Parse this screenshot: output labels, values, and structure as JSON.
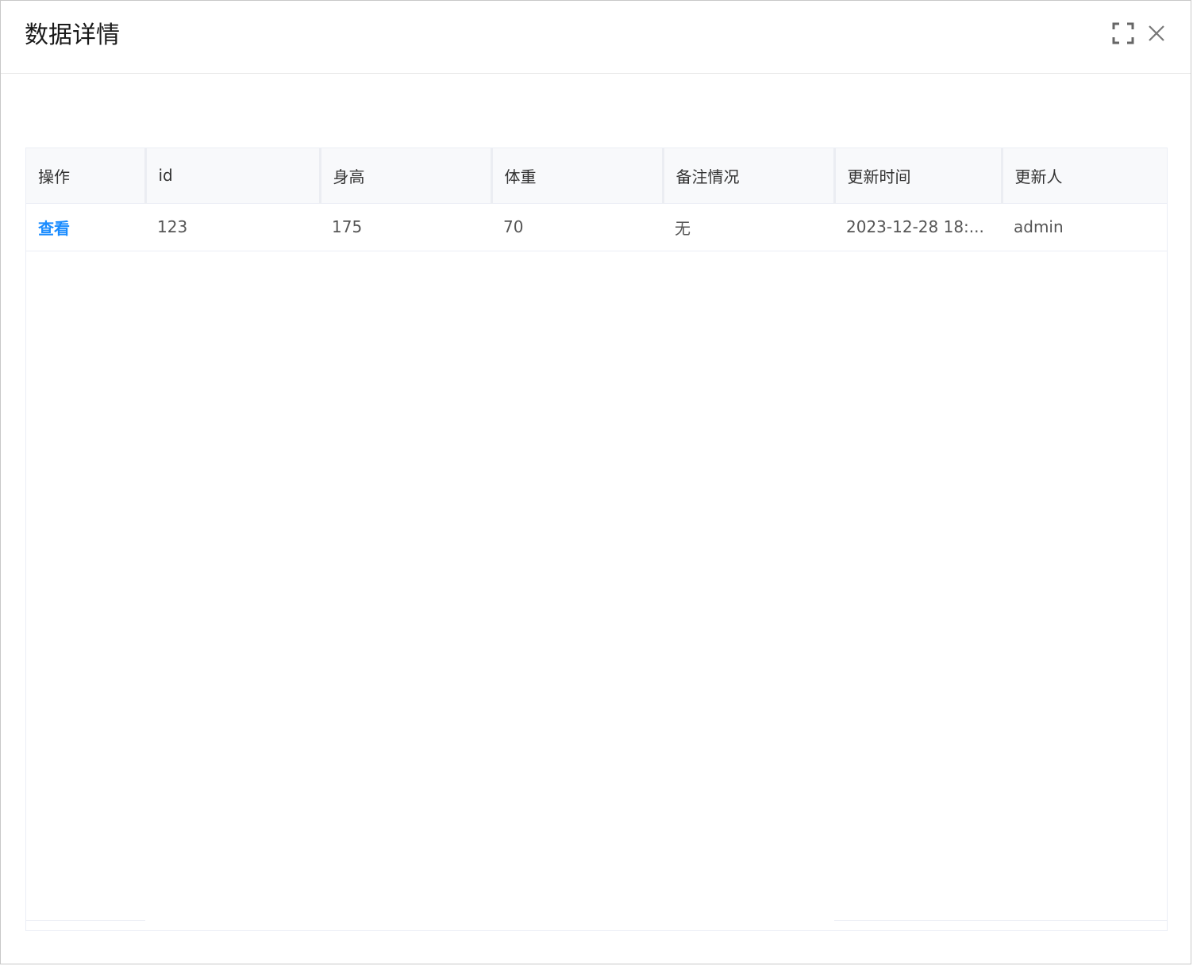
{
  "dialog": {
    "title": "数据详情",
    "maximize_icon": "maximize-icon",
    "close_icon": "close-icon"
  },
  "table": {
    "columns": [
      "操作",
      "id",
      "身高",
      "体重",
      "备注情况",
      "更新时间",
      "更新人"
    ],
    "rows": [
      {
        "action": "查看",
        "id": "123",
        "height": "175",
        "weight": "70",
        "remark": "无",
        "updated_at": "2023-12-28 18:...",
        "updated_by": "admin"
      }
    ]
  },
  "colors": {
    "link": "#1a8cff",
    "header_bg": "#f8f9fb",
    "border": "#ebeef5"
  }
}
